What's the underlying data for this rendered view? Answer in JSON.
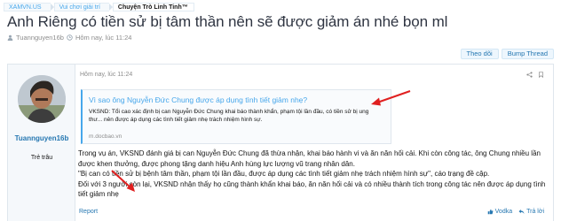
{
  "breadcrumb": {
    "items": [
      "XAMVN.US",
      "Vui chơi giải trí",
      "Chuyện Trò Linh Tinh™"
    ]
  },
  "thread": {
    "title": "Anh Riêng có tiền sử bị tâm thần nên sẽ được giảm án nhé bọn ml",
    "author": "Tuannguyen16b",
    "date": "Hôm nay, lúc 11:24"
  },
  "buttons": {
    "watch": "Theo dõi",
    "bump": "Bump Thread"
  },
  "post": {
    "date": "Hôm nay, lúc 11:24",
    "username": "Tuannguyen16b",
    "usertitle": "Trẻ trâu",
    "link_card": {
      "title": "Vì sao ông Nguyễn Đức Chung được áp dụng tình tiết giảm nhẹ?",
      "description": "VKSND: Tổi cao xác định bị can Nguyễn Đức Chung khai báo thành khẩn, phạm tội lần đầu, có tiền sử bị ung thư... nên được áp dụng các tình tiết giảm nhẹ trách nhiệm hình sự.",
      "domain": "m.docbao.vn"
    },
    "body": [
      "Trong vụ án, VKSND đánh giá bị can Nguyễn Đức Chung đã thừa nhận, khai báo hành vi và ăn năn hối cải. Khi còn công tác, ông Chung nhiều lần được khen thưởng, được phong tặng danh hiệu Anh hùng lực lượng vũ trang nhân dân.",
      "\"Bị can có tiền sử bị bệnh tâm thần, phạm tội lần đầu, được áp dụng các tình tiết giảm nhẹ trách nhiệm hình sự\", cáo trạng đề cập.",
      "Đối với 3 người còn lại, VKSND nhận thấy họ cũng thành khẩn khai báo, ăn năn hối cải và có nhiều thành tích trong công tác nên được áp dụng tình tiết giảm nhẹ"
    ],
    "report": "Report",
    "footer": {
      "like": "Vodka",
      "reply": "Trả lời"
    }
  },
  "colors": {
    "link": "#47a7eb",
    "accent": "#2577b1",
    "arrow": "#e02020"
  }
}
